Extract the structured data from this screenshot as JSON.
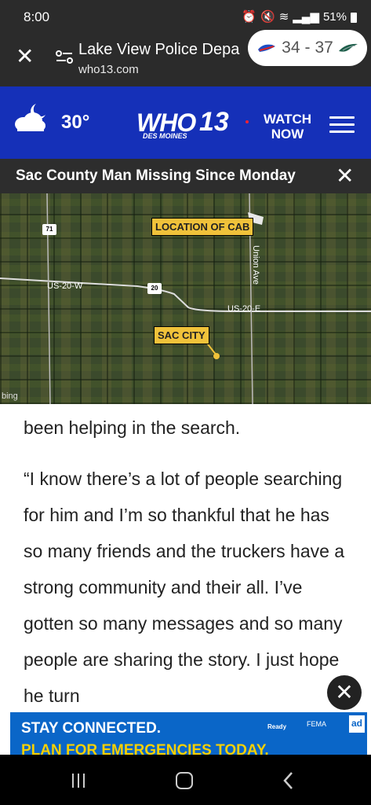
{
  "status": {
    "time": "8:00",
    "battery": "51%"
  },
  "browser": {
    "title": "Lake View Police Depa",
    "url": "who13.com",
    "score": {
      "home": "34",
      "separator": "-",
      "away": "37"
    }
  },
  "header": {
    "temperature": "30°",
    "logo_main": "WHO",
    "logo_num": "13",
    "logo_sub": "DES MOINES",
    "watch_line1": "WATCH",
    "watch_line2": "NOW"
  },
  "video": {
    "title": "Sac County Man Missing Since Monday"
  },
  "map": {
    "label_cab": "LOCATION OF CAB",
    "label_city": "SAC CITY",
    "road_us20w": "US-20-W",
    "road_us20e": "US-20-E",
    "road_union": "Union Ave",
    "shield_71": "71",
    "shield_20": "20",
    "credit": "bing"
  },
  "article": {
    "paragraphs": [
      "been helping in the search.",
      "“I know there’s a lot of people searching for him and I’m so thankful that he has so many friends and the truckers have a strong community and their all. I’ve gotten so many messages and so many people are sharing the story. I just hope he turn"
    ]
  },
  "ad": {
    "line1": "STAY CONNECTED.",
    "line2": "PLAN FOR EMERGENCIES TODAY.",
    "ready": "Ready",
    "fema": "FEMA",
    "badge": "ad"
  },
  "colors": {
    "header_blue": "#1530b8",
    "ad_blue": "#0a66c8",
    "ad_yellow": "#f6d000",
    "map_label": "#f0c23a"
  }
}
